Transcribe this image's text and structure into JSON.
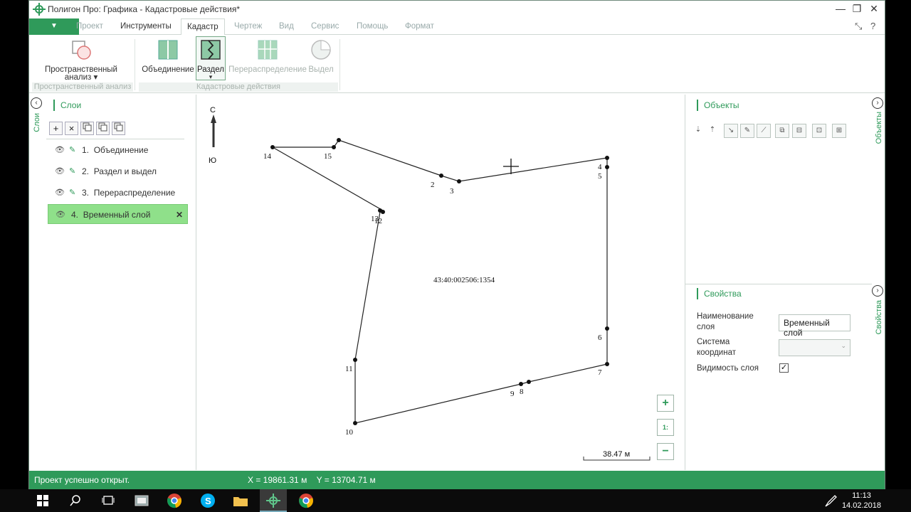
{
  "window": {
    "title": "Полигон Про: Графика - Кадастровые действия*",
    "min": "—",
    "max": "❐",
    "close": "✕"
  },
  "tabs": {
    "file_arrow": "▼",
    "items": [
      "Проект",
      "Инструменты",
      "Кадастр",
      "Чертеж",
      "Вид",
      "Сервис",
      "Помощь",
      "Формат"
    ],
    "active": "Кадастр",
    "help": "?",
    "layout_icon": "⤡"
  },
  "ribbon": {
    "spatial_line1": "Пространственный",
    "spatial_line2": "анализ",
    "spatial_arrow": "▾",
    "merge": "Объединение",
    "split": "Раздел",
    "split_arrow": "▾",
    "redistribute": "Перераспределение",
    "allocate": "Выдел",
    "group_spatial": "Пространственный анализ",
    "group_cadastral": "Кадастровые действия"
  },
  "left_panel": {
    "vertical_tab": "Слои",
    "title": "Слои",
    "tool_add": "+",
    "tool_delete": "×",
    "layers": [
      {
        "num": "1.",
        "name": "Объединение"
      },
      {
        "num": "2.",
        "name": "Раздел и выдел"
      },
      {
        "num": "3.",
        "name": "Перераспределение"
      },
      {
        "num": "4.",
        "name": "Временный слой"
      }
    ],
    "selected_index": 3
  },
  "canvas": {
    "north": "С",
    "south": "Ю",
    "parcel_label": "43:40:002506:1354",
    "points": [
      {
        "label": "2"
      },
      {
        "label": "3"
      },
      {
        "label": "4"
      },
      {
        "label": "5"
      },
      {
        "label": "6"
      },
      {
        "label": "7"
      },
      {
        "label": "8"
      },
      {
        "label": "9"
      },
      {
        "label": "10"
      },
      {
        "label": "11"
      },
      {
        "label": "12"
      },
      {
        "label": "13"
      },
      {
        "label": "14"
      },
      {
        "label": "15"
      }
    ],
    "scale_text": "38.47 м",
    "zoom_in": "+",
    "zoom_out": "−",
    "scale_btn": "1:"
  },
  "right_panel": {
    "objects_tab": "Объекты",
    "objects_title": "Объекты",
    "props_tab": "Свойства",
    "props_title": "Свойства",
    "name_label_1": "Наименование",
    "name_label_2": "слоя",
    "name_value": "Временный слой",
    "crs_label_1": "Система",
    "crs_label_2": "координат",
    "crs_value": "",
    "visibility_label": "Видимость слоя",
    "visibility_checked": "✓"
  },
  "status": {
    "message": "Проект успешно открыт.",
    "coords": "X = 19861.31 м    Y = 13704.71 м"
  },
  "taskbar": {
    "time": "11:13",
    "date": "14.02.2018"
  },
  "colors": {
    "accent": "#2f9a5a",
    "selected_layer": "#8fe08a"
  }
}
